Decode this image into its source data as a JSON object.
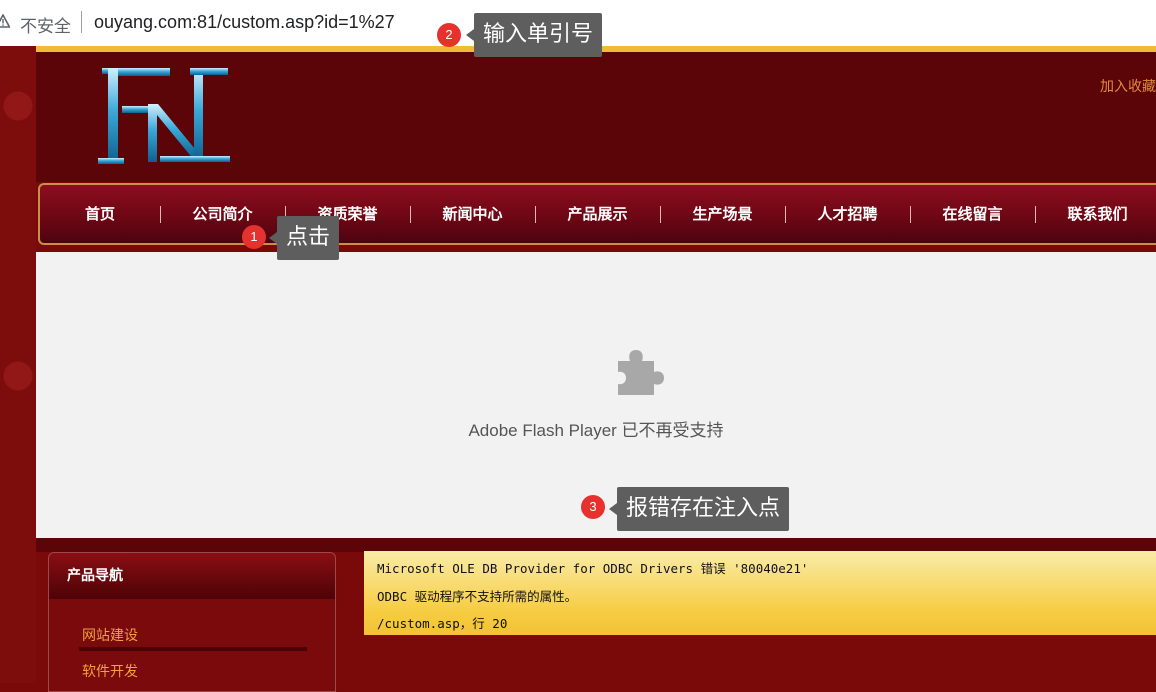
{
  "browser": {
    "security_label": "不安全",
    "url": "ouyang.com:81/custom.asp?id=1%27"
  },
  "header": {
    "favorites_link": "加入收藏"
  },
  "nav": {
    "items": [
      "首页",
      "公司简介",
      "资质荣誉",
      "新闻中心",
      "产品展示",
      "生产场景",
      "人才招聘",
      "在线留言",
      "联系我们"
    ]
  },
  "flash": {
    "message": "Adobe Flash Player 已不再受支持"
  },
  "sidebar": {
    "title": "产品导航",
    "links": [
      "网站建设",
      "软件开发"
    ]
  },
  "error": {
    "line1": "Microsoft OLE DB Provider for ODBC Drivers 错误 '80040e21'",
    "line2": "ODBC 驱动程序不支持所需的属性。",
    "line3": "/custom.asp，行 20"
  },
  "annotations": [
    {
      "number": "1",
      "text": "点击"
    },
    {
      "number": "2",
      "text": "输入单引号"
    },
    {
      "number": "3",
      "text": "报错存在注入点"
    }
  ],
  "colors": {
    "header_bg": "#5c0508",
    "nav_border": "#c79245",
    "link_orange": "#f0a040",
    "error_bg": "#f7cd45",
    "badge_red": "#e5322f"
  }
}
